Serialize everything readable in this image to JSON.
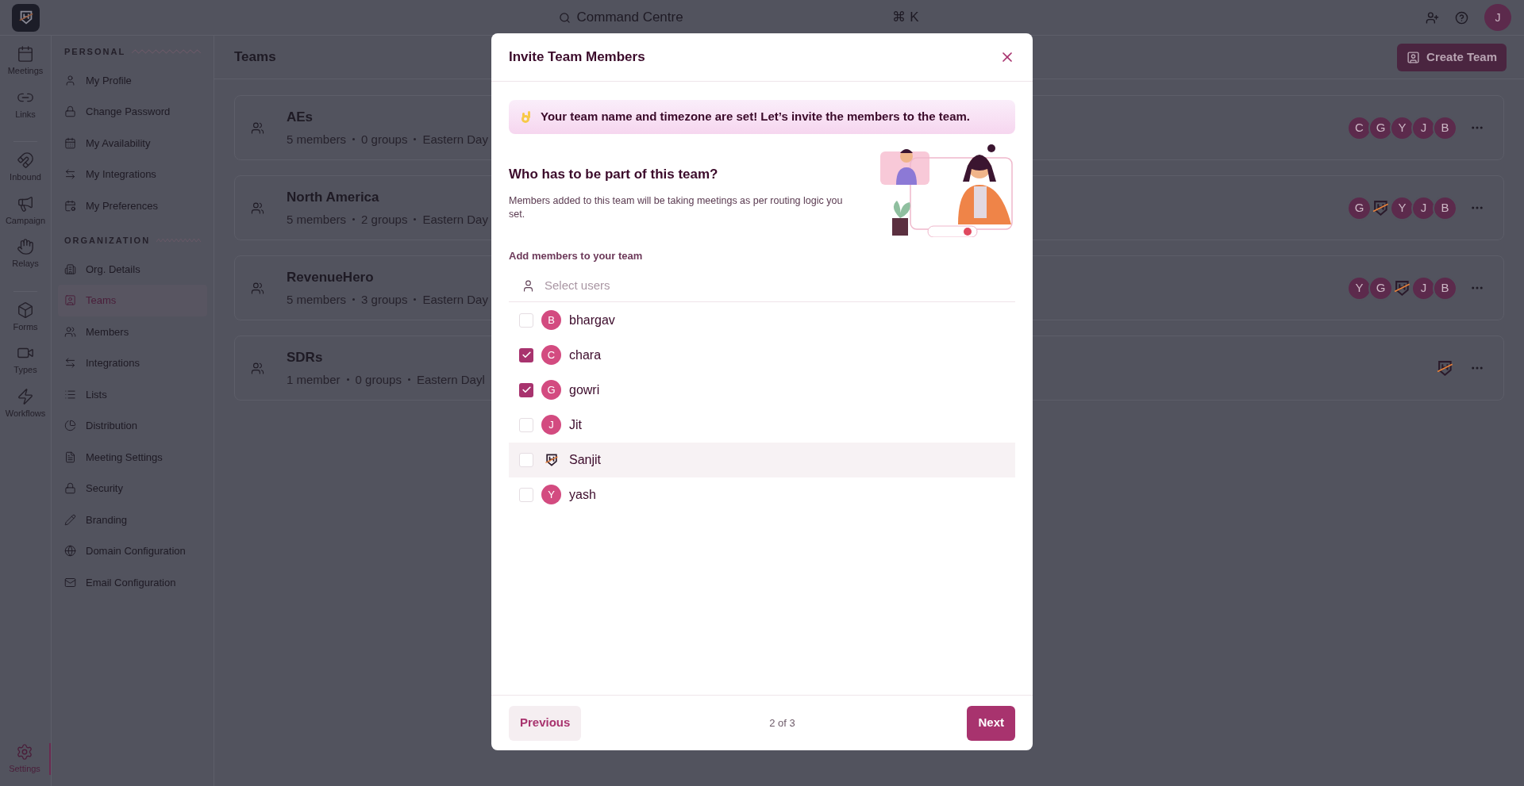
{
  "top_bar": {
    "search_label": "Command Centre",
    "shortcut": "⌘ K",
    "avatar_letter": "J"
  },
  "rail": [
    {
      "label": "Meetings",
      "selected": false
    },
    {
      "label": "Links",
      "selected": false
    },
    {
      "label": "Inbound",
      "selected": false
    },
    {
      "label": "Campaign",
      "selected": false
    },
    {
      "label": "Relays",
      "selected": false
    },
    {
      "label": "Forms",
      "selected": false
    },
    {
      "label": "Types",
      "selected": false
    },
    {
      "label": "Workflows",
      "selected": false
    },
    {
      "label": "Settings",
      "selected": true
    }
  ],
  "sidebar": {
    "sections": [
      {
        "heading": "PERSONAL",
        "items": [
          {
            "label": "My Profile",
            "selected": false
          },
          {
            "label": "Change Password",
            "selected": false
          },
          {
            "label": "My Availability",
            "selected": false
          },
          {
            "label": "My Integrations",
            "selected": false
          },
          {
            "label": "My Preferences",
            "selected": false
          }
        ]
      },
      {
        "heading": "ORGANIZATION",
        "items": [
          {
            "label": "Org. Details",
            "selected": false
          },
          {
            "label": "Teams",
            "selected": true
          },
          {
            "label": "Members",
            "selected": false
          },
          {
            "label": "Integrations",
            "selected": false
          },
          {
            "label": "Lists",
            "selected": false
          },
          {
            "label": "Distribution",
            "selected": false
          },
          {
            "label": "Meeting Settings",
            "selected": false
          },
          {
            "label": "Security",
            "selected": false
          },
          {
            "label": "Branding",
            "selected": false
          },
          {
            "label": "Domain Configuration",
            "selected": false
          },
          {
            "label": "Email Configuration",
            "selected": false
          }
        ]
      }
    ]
  },
  "page": {
    "title": "Teams",
    "create_button": "Create Team"
  },
  "teams": [
    {
      "name": "AEs",
      "details": [
        "5 members",
        "0 groups",
        "Eastern Day"
      ],
      "avatars": [
        {
          "kind": "letter",
          "letter": "C"
        },
        {
          "kind": "letter",
          "letter": "G"
        },
        {
          "kind": "letter",
          "letter": "Y"
        },
        {
          "kind": "letter",
          "letter": "J"
        },
        {
          "kind": "letter",
          "letter": "B"
        }
      ]
    },
    {
      "name": "North America",
      "details": [
        "5 members",
        "2 groups",
        "Eastern Day"
      ],
      "avatars": [
        {
          "kind": "letter",
          "letter": "G"
        },
        {
          "kind": "logo"
        },
        {
          "kind": "letter",
          "letter": "Y"
        },
        {
          "kind": "letter",
          "letter": "J"
        },
        {
          "kind": "letter",
          "letter": "B"
        }
      ]
    },
    {
      "name": "RevenueHero",
      "details": [
        "5 members",
        "3 groups",
        "Eastern Day"
      ],
      "avatars": [
        {
          "kind": "letter",
          "letter": "Y"
        },
        {
          "kind": "letter",
          "letter": "G"
        },
        {
          "kind": "logo"
        },
        {
          "kind": "letter",
          "letter": "J"
        },
        {
          "kind": "letter",
          "letter": "B"
        }
      ]
    },
    {
      "name": "SDRs",
      "details": [
        "1 member",
        "0 groups",
        "Eastern Dayl"
      ],
      "avatars": [
        {
          "kind": "logo"
        }
      ]
    }
  ],
  "dialog": {
    "title": "Invite Team Members",
    "banner": "Your team name and timezone are set! Let’s invite the members to the team.",
    "heading": "Who has to be part of this team?",
    "description": "Members added to this team will be taking meetings as per routing logic you set.",
    "field_label": "Add members to your team",
    "search": {
      "placeholder": "Select users"
    },
    "members": [
      {
        "name": "bhargav",
        "checked": false,
        "highlighted": false,
        "avatar": {
          "kind": "letter",
          "letter": "B"
        }
      },
      {
        "name": "chara",
        "checked": true,
        "highlighted": false,
        "avatar": {
          "kind": "letter",
          "letter": "C"
        }
      },
      {
        "name": "gowri",
        "checked": true,
        "highlighted": false,
        "avatar": {
          "kind": "letter",
          "letter": "G"
        }
      },
      {
        "name": "Jit",
        "checked": false,
        "highlighted": false,
        "avatar": {
          "kind": "letter",
          "letter": "J"
        }
      },
      {
        "name": "Sanjit",
        "checked": false,
        "highlighted": true,
        "avatar": {
          "kind": "logo"
        }
      },
      {
        "name": "yash",
        "checked": false,
        "highlighted": false,
        "avatar": {
          "kind": "letter",
          "letter": "Y"
        }
      }
    ],
    "previous_button": "Previous",
    "step": "2 of 3",
    "next_button": "Next"
  }
}
